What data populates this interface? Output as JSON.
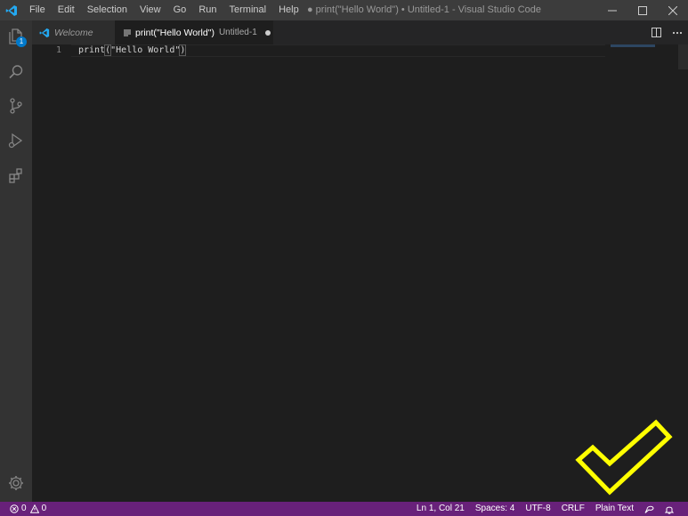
{
  "window": {
    "title": "● print(\"Hello World\") • Untitled-1 - Visual Studio Code"
  },
  "menu": [
    "File",
    "Edit",
    "Selection",
    "View",
    "Go",
    "Run",
    "Terminal",
    "Help"
  ],
  "activity_bar": {
    "explorer_badge": "1",
    "items": [
      "files-icon",
      "search-icon",
      "source-control-icon",
      "run-debug-icon",
      "extensions-icon"
    ],
    "bottom": "gear-icon"
  },
  "tabs": [
    {
      "label": "Welcome",
      "active": false
    },
    {
      "label": "print(\"Hello World\")",
      "sublabel": "Untitled-1",
      "active": true,
      "dirty": true
    }
  ],
  "editor": {
    "line_number": "1",
    "code_prefix": "print",
    "code_open": "(",
    "code_string": "\"Hello World\"",
    "code_close": ")"
  },
  "status_bar": {
    "errors": "0",
    "warnings": "0",
    "cursor": "Ln 1, Col 21",
    "indent": "Spaces: 4",
    "encoding": "UTF-8",
    "eol": "CRLF",
    "language": "Plain Text",
    "color": "#68217a"
  },
  "overlay": {
    "icon": "checkmark-icon",
    "color": "#ffff00"
  }
}
